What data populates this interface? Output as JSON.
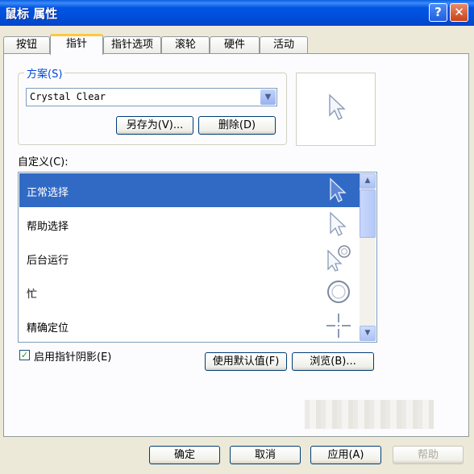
{
  "window": {
    "title": "鼠标 属性",
    "help_glyph": "?",
    "close_glyph": "✕"
  },
  "tabs": [
    {
      "label": "按钮"
    },
    {
      "label": "指针"
    },
    {
      "label": "指针选项"
    },
    {
      "label": "滚轮"
    },
    {
      "label": "硬件"
    },
    {
      "label": "活动"
    }
  ],
  "active_tab": "指针",
  "scheme": {
    "label": "方案(S)",
    "selected": "Crystal Clear",
    "save_as": "另存为(V)...",
    "delete": "删除(D)"
  },
  "customize": {
    "label": "自定义(C):",
    "items": [
      {
        "label": "正常选择",
        "icon": "arrow-cursor-icon",
        "selected": true
      },
      {
        "label": "帮助选择",
        "icon": "help-cursor-icon",
        "selected": false
      },
      {
        "label": "后台运行",
        "icon": "working-in-background-cursor-icon",
        "selected": false
      },
      {
        "label": "忙",
        "icon": "busy-cursor-icon",
        "selected": false
      },
      {
        "label": "精确定位",
        "icon": "precision-crosshair-icon",
        "selected": false
      }
    ]
  },
  "shadow": {
    "label": "启用指针阴影(E)",
    "checked": true
  },
  "use_default": "使用默认值(F)",
  "browse": "浏览(B)...",
  "footer": {
    "ok": "确定",
    "cancel": "取消",
    "apply": "应用(A)",
    "help": "帮助"
  },
  "colors": {
    "titlebar": "#0054e3",
    "selection": "#316ac5",
    "tab_highlight": "#ffc83c",
    "dialog_bg": "#ece9d8"
  }
}
